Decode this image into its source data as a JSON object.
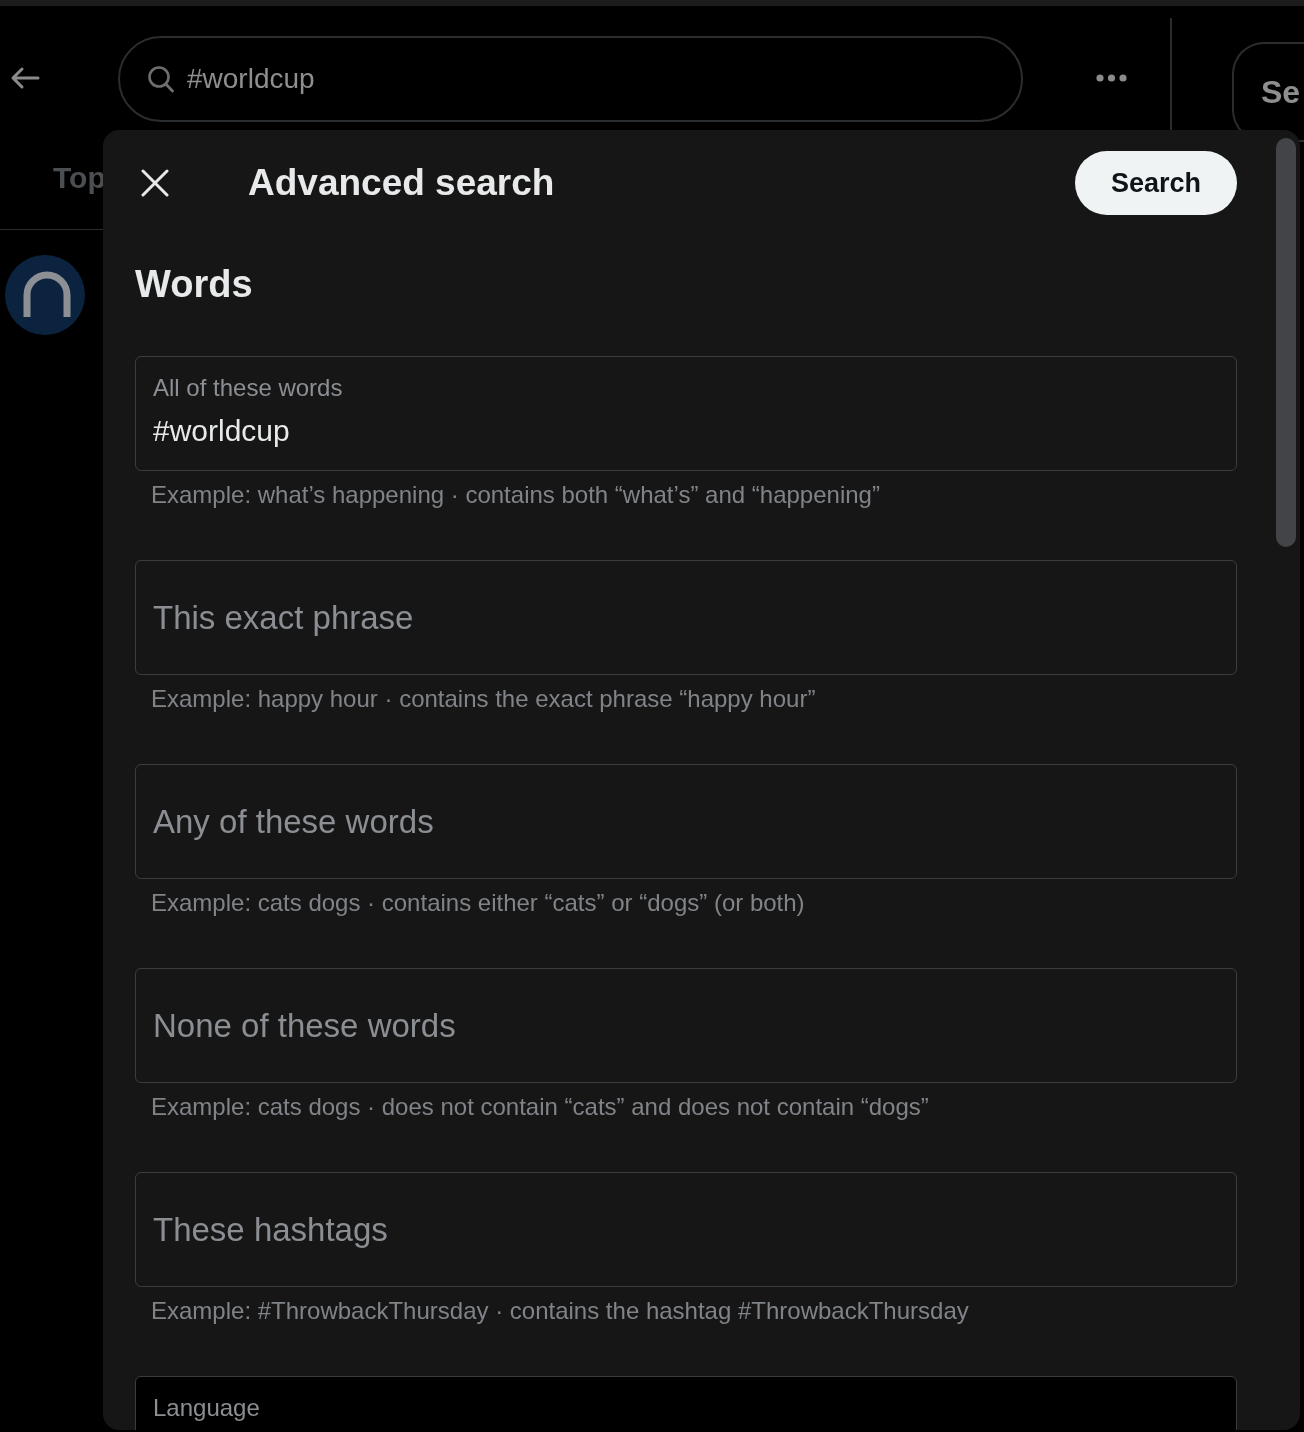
{
  "top_bar": {
    "search": {
      "value": "#worldcup"
    }
  },
  "tabs": [
    {
      "label": "Top"
    }
  ],
  "side_button": {
    "label": "Se"
  },
  "dialog": {
    "title": "Advanced search",
    "search_button": "Search",
    "section_title": "Words",
    "fields": [
      {
        "kind": "filled",
        "label": "All of these words",
        "value": "#worldcup",
        "hint": "Example: what’s happening · contains both “what’s” and “happening”"
      },
      {
        "kind": "empty",
        "placeholder": "This exact phrase",
        "hint": "Example: happy hour · contains the exact phrase “happy hour”"
      },
      {
        "kind": "empty",
        "placeholder": "Any of these words",
        "hint": "Example: cats dogs · contains either “cats” or “dogs” (or both)"
      },
      {
        "kind": "empty",
        "placeholder": "None of these words",
        "hint": "Example: cats dogs · does not contain “cats” and does not contain “dogs”"
      },
      {
        "kind": "empty",
        "placeholder": "These hashtags",
        "hint": "Example: #ThrowbackThursday · contains the hashtag #ThrowbackThursday"
      }
    ],
    "language": {
      "label": "Language"
    }
  }
}
